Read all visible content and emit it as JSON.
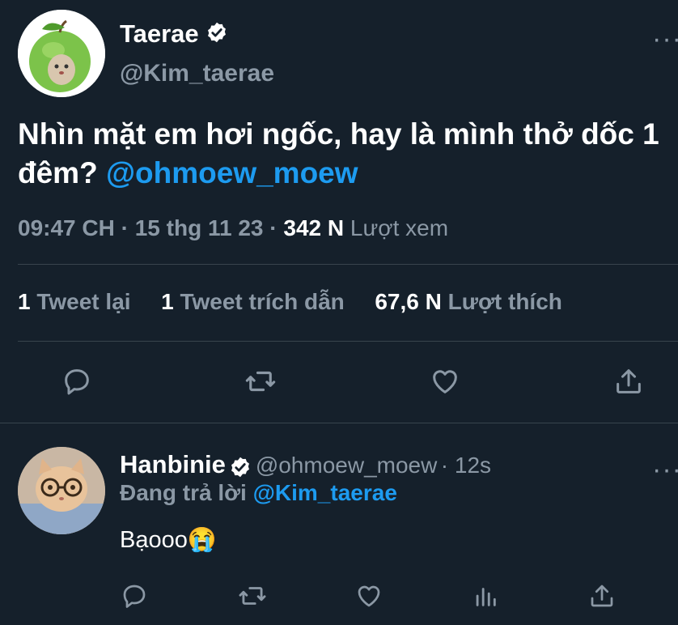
{
  "tweet": {
    "author_name": "Taerae",
    "author_handle": "@Kim_taerae",
    "more_icon": "more-dots-icon",
    "text": "Nhìn mặt em hơi ngốc, hay là mình thở dốc 1 đêm?",
    "mention": "@ohmoew_moew",
    "time": "09:47 CH",
    "date": "15 thg 11 23",
    "views_count": "342 N",
    "views_label": "Lượt xem",
    "retweets_count": "1",
    "retweets_label": "Tweet lại",
    "quotes_count": "1",
    "quotes_label": "Tweet trích dẫn",
    "likes_count": "67,6 N",
    "likes_label": "Lượt thích"
  },
  "reply": {
    "author_name": "Hanbinie",
    "author_handle": "@ohmoew_moew",
    "time": "12s",
    "replying_label": "Đang trả lời",
    "replying_to": "@Kim_taerae",
    "text": "Bạooo😭"
  },
  "colors": {
    "background": "#15202b",
    "accent": "#1d9bf0",
    "muted": "#8b98a5",
    "divider": "#38444d"
  }
}
